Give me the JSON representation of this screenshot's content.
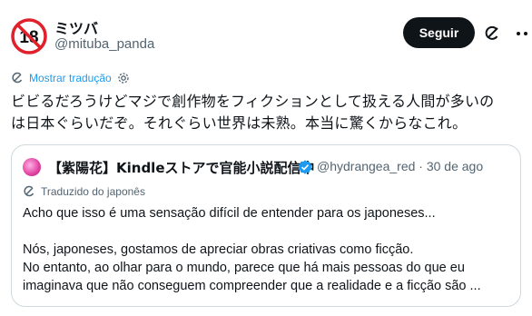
{
  "author": {
    "name": "ミツバ",
    "handle": "@mituba_panda",
    "avatar_text": "18"
  },
  "actions": {
    "follow_label": "Seguir"
  },
  "translation": {
    "label": "Mostrar tradução"
  },
  "tweet": {
    "line1": "ビビるだろうけどマジで創作物をフィクションとして扱える人間が多いの",
    "line2": "は日本ぐらいだぞ。それぐらい世界は未熟。本当に驚くからなこれ。"
  },
  "quote": {
    "name": "【紫陽花】Kindleストアで官能小説配信中",
    "handle_time": "@hydrangea_red · 30 de ago",
    "translated_label": "Traduzido do japonês",
    "para1": "Acho que isso é uma sensação difícil de entender para os japoneses...",
    "para2_line1": "Nós, japoneses, gostamos de apreciar obras criativas como ficção.",
    "para2_line2": "No entanto, ao olhar para o mundo, parece que há mais pessoas do que eu",
    "para2_line3": "imaginava que não conseguem compreender que a realidade e a ficção são ..."
  },
  "colors": {
    "accent": "#1d9bf0",
    "secondary_text": "#536471",
    "button_bg": "#0f1419",
    "border": "#cfd9de",
    "badge_red": "#e0202a"
  }
}
